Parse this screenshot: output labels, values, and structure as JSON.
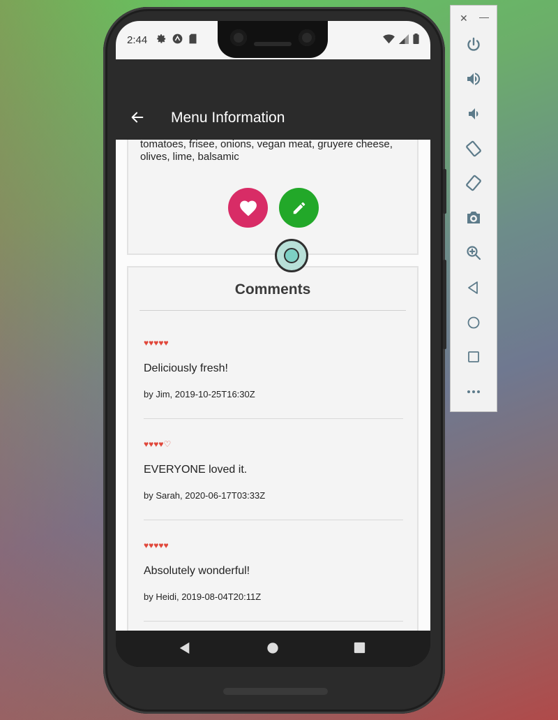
{
  "status_bar": {
    "time": "2:44"
  },
  "app_bar": {
    "title": "Menu Information"
  },
  "dish": {
    "ingredients": "tomatoes, frisee, onions, vegan meat, gruyere cheese, olives, lime, balsamic"
  },
  "comments_section": {
    "title": "Comments",
    "items": [
      {
        "rating": 5,
        "stars": "♥♥♥♥♥",
        "text": "Deliciously fresh!",
        "author_line": "by Jim, 2019-10-25T16:30Z"
      },
      {
        "rating": 4,
        "stars": "♥♥♥♥♡",
        "text": "EVERYONE loved it.",
        "author_line": "by Sarah, 2020-06-17T03:33Z"
      },
      {
        "rating": 5,
        "stars": "♥♥♥♥♥",
        "text": "Absolutely wonderful!",
        "author_line": "by Heidi, 2019-08-04T20:11Z"
      }
    ]
  },
  "emulator_panel": {
    "close_label": "✕",
    "minimize_label": "—",
    "buttons": [
      "power-icon",
      "volume-up-icon",
      "volume-down-icon",
      "rotate-left-icon",
      "rotate-right-icon",
      "camera-icon",
      "zoom-icon",
      "back-icon",
      "home-icon",
      "overview-icon",
      "more-icon"
    ]
  },
  "colors": {
    "app_bar": "#2b2b2b",
    "favorite_button": "#d82c66",
    "edit_button": "#22a829",
    "rating_hearts": "#e0473a"
  }
}
